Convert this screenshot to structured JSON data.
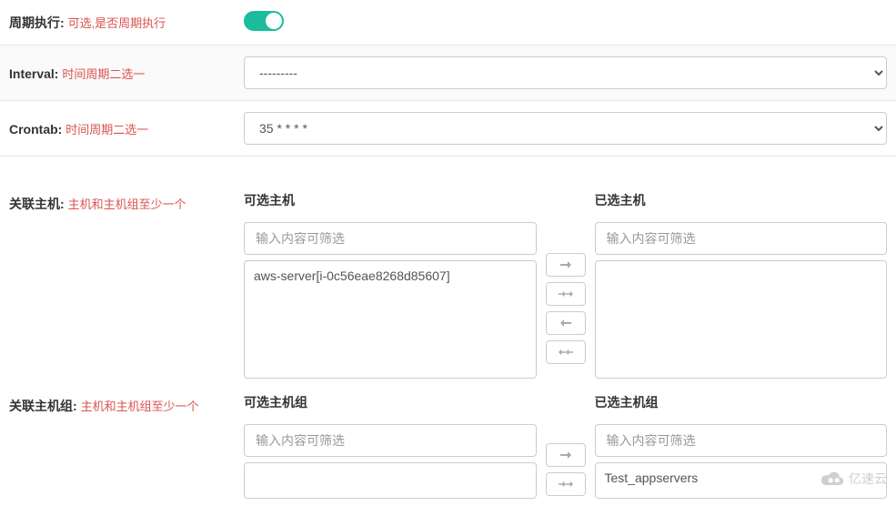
{
  "periodic": {
    "label": "周期执行:",
    "sub": "可选,是否周期执行",
    "enabled": true
  },
  "interval": {
    "label": "Interval:",
    "sub": "时间周期二选一",
    "value": "---------"
  },
  "crontab": {
    "label": "Crontab:",
    "sub": "时间周期二选一",
    "value": "35 * * * *"
  },
  "hosts": {
    "label": "关联主机:",
    "sub": "主机和主机组至少一个",
    "available_title": "可选主机",
    "selected_title": "已选主机",
    "filter_placeholder": "输入内容可筛选",
    "available_items": [
      "aws-server[i-0c56eae8268d85607]"
    ],
    "selected_items": []
  },
  "hostgroups": {
    "label": "关联主机组:",
    "sub": "主机和主机组至少一个",
    "available_title": "可选主机组",
    "selected_title": "已选主机组",
    "filter_placeholder": "输入内容可筛选",
    "available_items": [],
    "selected_items": [
      "Test_appservers"
    ]
  },
  "watermark": "亿速云"
}
